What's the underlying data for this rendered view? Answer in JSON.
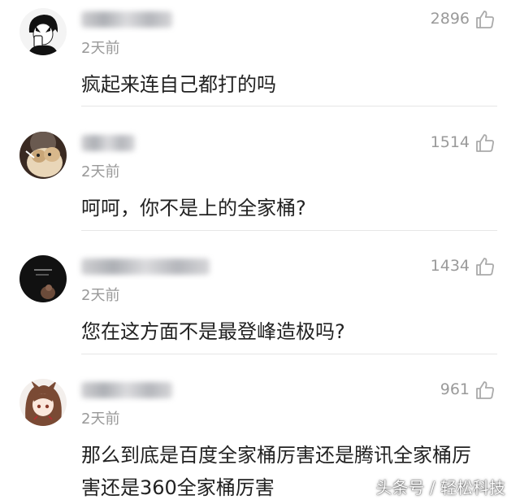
{
  "comments": [
    {
      "avatar_icon": "avatar-boy-drinking-icon",
      "likes": "2896",
      "time": "2天前",
      "text": "疯起来连自己都打的吗"
    },
    {
      "avatar_icon": "avatar-cat-icon",
      "likes": "1514",
      "time": "2天前",
      "text": "呵呵，你不是上的全家桶?"
    },
    {
      "avatar_icon": "avatar-dark-photo-icon",
      "likes": "1434",
      "time": "2天前",
      "text": "您在这方面不是最登峰造极吗?"
    },
    {
      "avatar_icon": "avatar-anime-girl-icon",
      "likes": "961",
      "time": "2天前",
      "text": "那么到底是百度全家桶厉害还是腾讯全家桶厉害还是360全家桶厉害"
    }
  ],
  "like_icon": "thumbs-up-icon",
  "watermark": "头条号 / 轻松科技"
}
